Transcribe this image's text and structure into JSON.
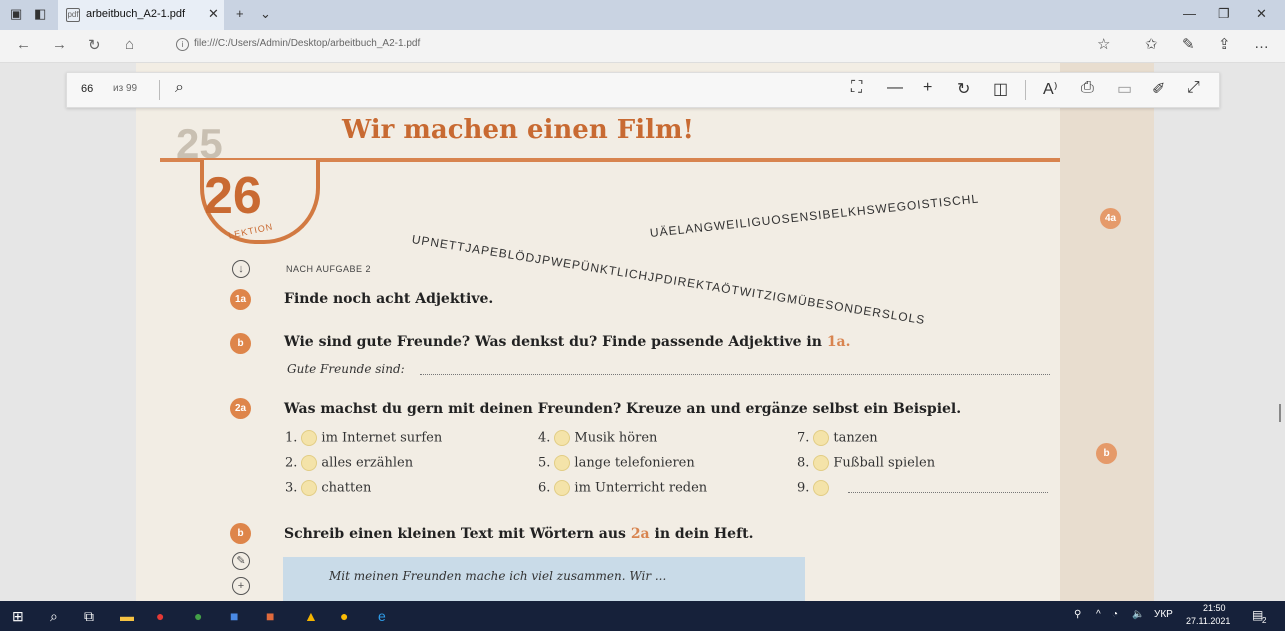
{
  "browser": {
    "tab_title": "arbeitbuch_A2-1.pdf",
    "url": "file:///C:/Users/Admin/Desktop/arbeitbuch_A2-1.pdf"
  },
  "pdf_toolbar": {
    "page_number": "66",
    "page_of": "из 99"
  },
  "page": {
    "title": "Wir machen einen Film!",
    "lesson_number": "26",
    "lesson_label": "LEKTION",
    "faded_lesson_number": "25",
    "nach_aufgabe": "NACH AUFGABE 2",
    "letter_line_1": "UPNETTJAPEBLÖDJPWEPÜNKTLICHJPDIREKTAÖTWITZIGMÜBESONDERSLOLS",
    "letter_line_2": "UÄELANGWEILIGUOSENSIBELKHSWEGOISTISCHL",
    "task_1a_badge": "1a",
    "task_1a": "Finde noch acht Adjektive.",
    "task_1b_badge": "b",
    "task_1b": "Wie sind gute Freunde? Was denkst du? Finde passende Adjektive in",
    "task_1b_ref": "1a.",
    "gute_freunde": "Gute Freunde sind:",
    "task_2a_badge": "2a",
    "task_2a": "Was machst du gern mit deinen Freunden? Kreuze an und ergänze selbst ein Beispiel.",
    "items": [
      {
        "num": "1.",
        "text": "im Internet surfen"
      },
      {
        "num": "2.",
        "text": "alles erzählen"
      },
      {
        "num": "3.",
        "text": "chatten"
      },
      {
        "num": "4.",
        "text": "Musik hören"
      },
      {
        "num": "5.",
        "text": "lange telefonieren"
      },
      {
        "num": "6.",
        "text": "im Unterricht reden"
      },
      {
        "num": "7.",
        "text": "tanzen"
      },
      {
        "num": "8.",
        "text": "Fußball spielen"
      },
      {
        "num": "9.",
        "text": ""
      }
    ],
    "task_2b_badge": "b",
    "task_2b_pre": "Schreib einen kleinen Text mit Wörtern aus",
    "task_2b_ref": "2a",
    "task_2b_post": "in dein Heft.",
    "example_text": "Mit meinen Freunden mache ich viel zusammen. Wir ...",
    "right_badge_4a": "4a",
    "right_badge_b": "b"
  },
  "taskbar": {
    "lang": "УКР",
    "time": "21:50",
    "date": "27.11.2021",
    "notif_count": "2"
  }
}
